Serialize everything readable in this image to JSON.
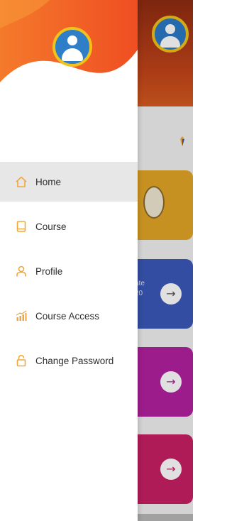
{
  "colors": {
    "accent": "#f2a73b",
    "header_wave": "#f25d24",
    "avatar_ring": "#f1c21b",
    "avatar_fill": "#2f7ec8",
    "active_row": "#e7e7e7",
    "card_1": "#e3a626",
    "card_2": "#3a58b8",
    "card_3": "#b3209f",
    "card_4": "#c81f63"
  },
  "drawer": {
    "avatar_icon": "user-avatar-icon",
    "menu": [
      {
        "label": "Home",
        "icon": "home-icon",
        "active": true
      },
      {
        "label": "Course",
        "icon": "book-icon",
        "active": false
      },
      {
        "label": "Profile",
        "icon": "person-icon",
        "active": false
      },
      {
        "label": "Course Access",
        "icon": "chart-icon",
        "active": false
      },
      {
        "label": "Change Password",
        "icon": "lock-icon",
        "active": false
      }
    ]
  },
  "background": {
    "card_2_fragment_line1": "ate",
    "card_2_fragment_line2": "20",
    "arrow_icon": "arrow-right-icon",
    "arrow_glyph": "→"
  }
}
